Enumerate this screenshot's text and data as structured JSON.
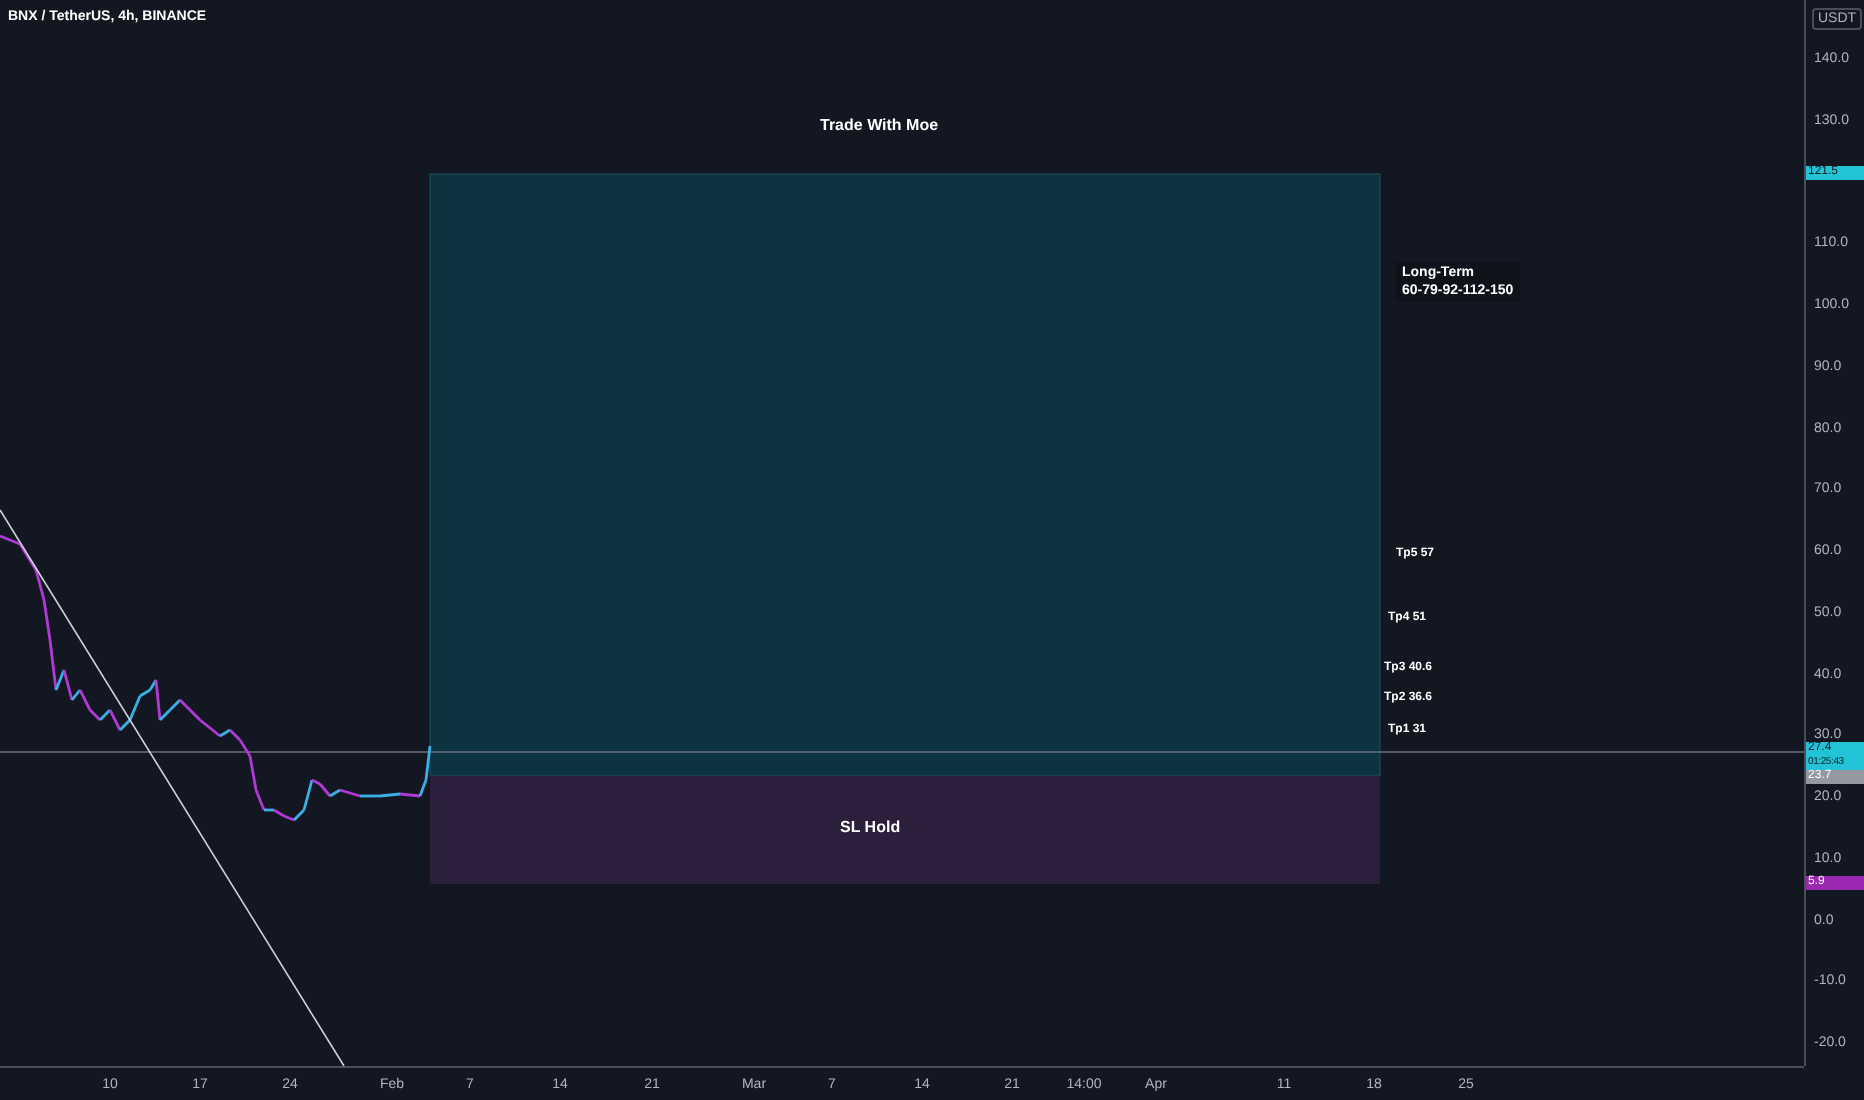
{
  "header": {
    "symbol": "BNX / TetherUS, 4h, BINANCE"
  },
  "position": {
    "title": "Trade With Moe",
    "stop_label": "SL Hold",
    "note": [
      "Long-Term",
      "60-79-92-112-150"
    ],
    "targets": [
      "Tp5 57",
      "Tp4 51",
      "Tp3 40.6",
      "Tp2 36.6",
      "Tp1 31"
    ]
  },
  "price_axis": {
    "currency": "USDT",
    "ticks": [
      "140.0",
      "130.0",
      "110.0",
      "100.0",
      "90.0",
      "80.0",
      "70.0",
      "60.0",
      "50.0",
      "40.0",
      "30.0",
      "20.0",
      "10.0",
      "0.0",
      "-10.0",
      "-20.0"
    ]
  },
  "price_tags": [
    {
      "kind": "target",
      "value": "121.5"
    },
    {
      "kind": "last",
      "value": "27.4",
      "countdown": "01:25:43"
    },
    {
      "kind": "entry",
      "value": "23.7"
    },
    {
      "kind": "stop",
      "value": "5.9"
    }
  ],
  "time_axis": [
    "10",
    "17",
    "24",
    "Feb",
    "7",
    "14",
    "21",
    "Mar",
    "7",
    "14",
    "21",
    "14:00",
    "Apr",
    "11",
    "18",
    "25"
  ]
}
